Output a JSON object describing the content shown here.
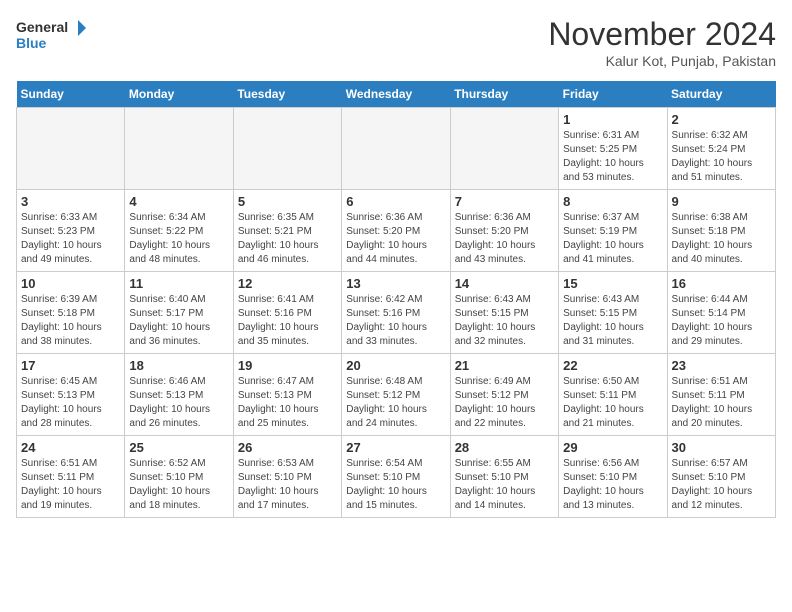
{
  "header": {
    "logo_line1": "General",
    "logo_line2": "Blue",
    "title": "November 2024",
    "location": "Kalur Kot, Punjab, Pakistan"
  },
  "weekdays": [
    "Sunday",
    "Monday",
    "Tuesday",
    "Wednesday",
    "Thursday",
    "Friday",
    "Saturday"
  ],
  "weeks": [
    [
      {
        "day": "",
        "info": ""
      },
      {
        "day": "",
        "info": ""
      },
      {
        "day": "",
        "info": ""
      },
      {
        "day": "",
        "info": ""
      },
      {
        "day": "",
        "info": ""
      },
      {
        "day": "1",
        "info": "Sunrise: 6:31 AM\nSunset: 5:25 PM\nDaylight: 10 hours and 53 minutes."
      },
      {
        "day": "2",
        "info": "Sunrise: 6:32 AM\nSunset: 5:24 PM\nDaylight: 10 hours and 51 minutes."
      }
    ],
    [
      {
        "day": "3",
        "info": "Sunrise: 6:33 AM\nSunset: 5:23 PM\nDaylight: 10 hours and 49 minutes."
      },
      {
        "day": "4",
        "info": "Sunrise: 6:34 AM\nSunset: 5:22 PM\nDaylight: 10 hours and 48 minutes."
      },
      {
        "day": "5",
        "info": "Sunrise: 6:35 AM\nSunset: 5:21 PM\nDaylight: 10 hours and 46 minutes."
      },
      {
        "day": "6",
        "info": "Sunrise: 6:36 AM\nSunset: 5:20 PM\nDaylight: 10 hours and 44 minutes."
      },
      {
        "day": "7",
        "info": "Sunrise: 6:36 AM\nSunset: 5:20 PM\nDaylight: 10 hours and 43 minutes."
      },
      {
        "day": "8",
        "info": "Sunrise: 6:37 AM\nSunset: 5:19 PM\nDaylight: 10 hours and 41 minutes."
      },
      {
        "day": "9",
        "info": "Sunrise: 6:38 AM\nSunset: 5:18 PM\nDaylight: 10 hours and 40 minutes."
      }
    ],
    [
      {
        "day": "10",
        "info": "Sunrise: 6:39 AM\nSunset: 5:18 PM\nDaylight: 10 hours and 38 minutes."
      },
      {
        "day": "11",
        "info": "Sunrise: 6:40 AM\nSunset: 5:17 PM\nDaylight: 10 hours and 36 minutes."
      },
      {
        "day": "12",
        "info": "Sunrise: 6:41 AM\nSunset: 5:16 PM\nDaylight: 10 hours and 35 minutes."
      },
      {
        "day": "13",
        "info": "Sunrise: 6:42 AM\nSunset: 5:16 PM\nDaylight: 10 hours and 33 minutes."
      },
      {
        "day": "14",
        "info": "Sunrise: 6:43 AM\nSunset: 5:15 PM\nDaylight: 10 hours and 32 minutes."
      },
      {
        "day": "15",
        "info": "Sunrise: 6:43 AM\nSunset: 5:15 PM\nDaylight: 10 hours and 31 minutes."
      },
      {
        "day": "16",
        "info": "Sunrise: 6:44 AM\nSunset: 5:14 PM\nDaylight: 10 hours and 29 minutes."
      }
    ],
    [
      {
        "day": "17",
        "info": "Sunrise: 6:45 AM\nSunset: 5:13 PM\nDaylight: 10 hours and 28 minutes."
      },
      {
        "day": "18",
        "info": "Sunrise: 6:46 AM\nSunset: 5:13 PM\nDaylight: 10 hours and 26 minutes."
      },
      {
        "day": "19",
        "info": "Sunrise: 6:47 AM\nSunset: 5:13 PM\nDaylight: 10 hours and 25 minutes."
      },
      {
        "day": "20",
        "info": "Sunrise: 6:48 AM\nSunset: 5:12 PM\nDaylight: 10 hours and 24 minutes."
      },
      {
        "day": "21",
        "info": "Sunrise: 6:49 AM\nSunset: 5:12 PM\nDaylight: 10 hours and 22 minutes."
      },
      {
        "day": "22",
        "info": "Sunrise: 6:50 AM\nSunset: 5:11 PM\nDaylight: 10 hours and 21 minutes."
      },
      {
        "day": "23",
        "info": "Sunrise: 6:51 AM\nSunset: 5:11 PM\nDaylight: 10 hours and 20 minutes."
      }
    ],
    [
      {
        "day": "24",
        "info": "Sunrise: 6:51 AM\nSunset: 5:11 PM\nDaylight: 10 hours and 19 minutes."
      },
      {
        "day": "25",
        "info": "Sunrise: 6:52 AM\nSunset: 5:10 PM\nDaylight: 10 hours and 18 minutes."
      },
      {
        "day": "26",
        "info": "Sunrise: 6:53 AM\nSunset: 5:10 PM\nDaylight: 10 hours and 17 minutes."
      },
      {
        "day": "27",
        "info": "Sunrise: 6:54 AM\nSunset: 5:10 PM\nDaylight: 10 hours and 15 minutes."
      },
      {
        "day": "28",
        "info": "Sunrise: 6:55 AM\nSunset: 5:10 PM\nDaylight: 10 hours and 14 minutes."
      },
      {
        "day": "29",
        "info": "Sunrise: 6:56 AM\nSunset: 5:10 PM\nDaylight: 10 hours and 13 minutes."
      },
      {
        "day": "30",
        "info": "Sunrise: 6:57 AM\nSunset: 5:10 PM\nDaylight: 10 hours and 12 minutes."
      }
    ]
  ]
}
